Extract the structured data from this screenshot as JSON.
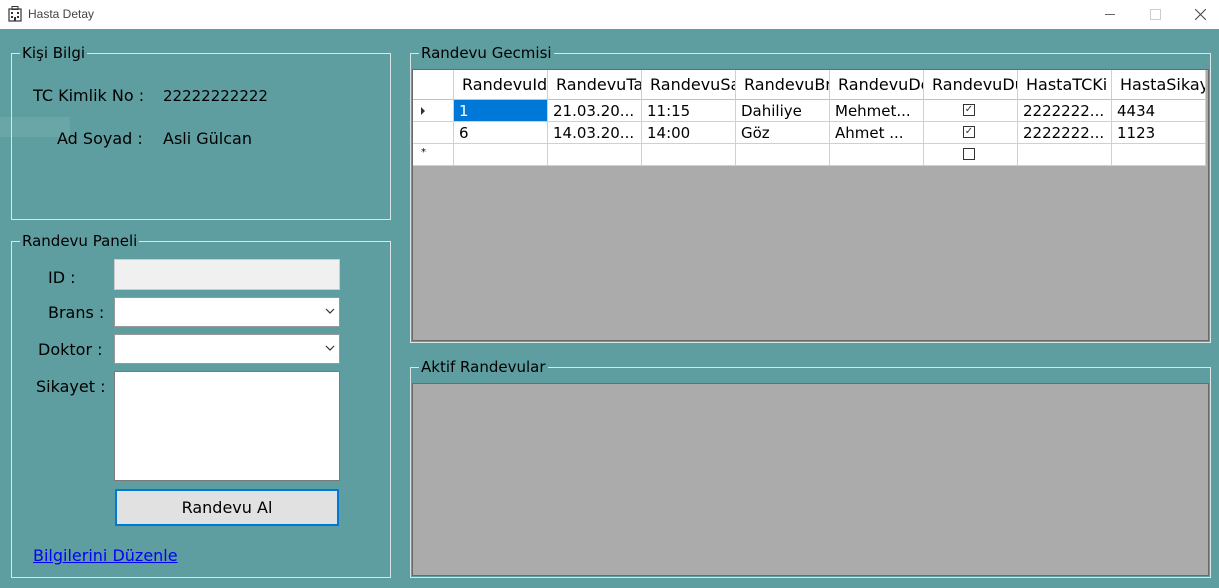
{
  "window": {
    "title": "Hasta Detay"
  },
  "kisi": {
    "legend": "Kişi Bilgi",
    "tc_label": "TC Kimlik No :",
    "tc_value": "22222222222",
    "ad_label": "Ad Soyad  :",
    "ad_value": "Asli Gülcan"
  },
  "randevu_panel": {
    "legend": "Randevu Paneli",
    "id_label": "ID :",
    "brans_label": "Brans :",
    "doktor_label": "Doktor :",
    "sikayet_label": "Sikayet :",
    "id_value": "",
    "brans_value": "",
    "doktor_value": "",
    "sikayet_value": "",
    "button_label": "Randevu Al",
    "link_label": "Bilgilerini Düzenle"
  },
  "gecmis": {
    "legend": "Randevu Gecmisi",
    "columns": [
      "RandevuId",
      "RandevuTa",
      "RandevuSa",
      "RandevuBr",
      "RandevuDo",
      "RandevuDu",
      "HastaTCKi",
      "HastaSikay"
    ],
    "rows": [
      [
        "1",
        "21.03.20...",
        "11:15",
        "Dahiliye",
        "Mehmet...",
        true,
        "2222222...",
        "4434"
      ],
      [
        "6",
        "14.03.20...",
        "14:00",
        "Göz",
        "Ahmet ...",
        true,
        "2222222...",
        "1123"
      ],
      [
        "",
        "",
        "",
        "",
        "",
        false,
        "",
        ""
      ]
    ],
    "current_row_marker": "▸",
    "new_row_marker": "*"
  },
  "aktif": {
    "legend": "Aktif Randevular"
  },
  "colors": {
    "background": "#5f9ea0",
    "grid_background": "#ababab",
    "selection": "#0078d7",
    "link": "#0000ff"
  }
}
